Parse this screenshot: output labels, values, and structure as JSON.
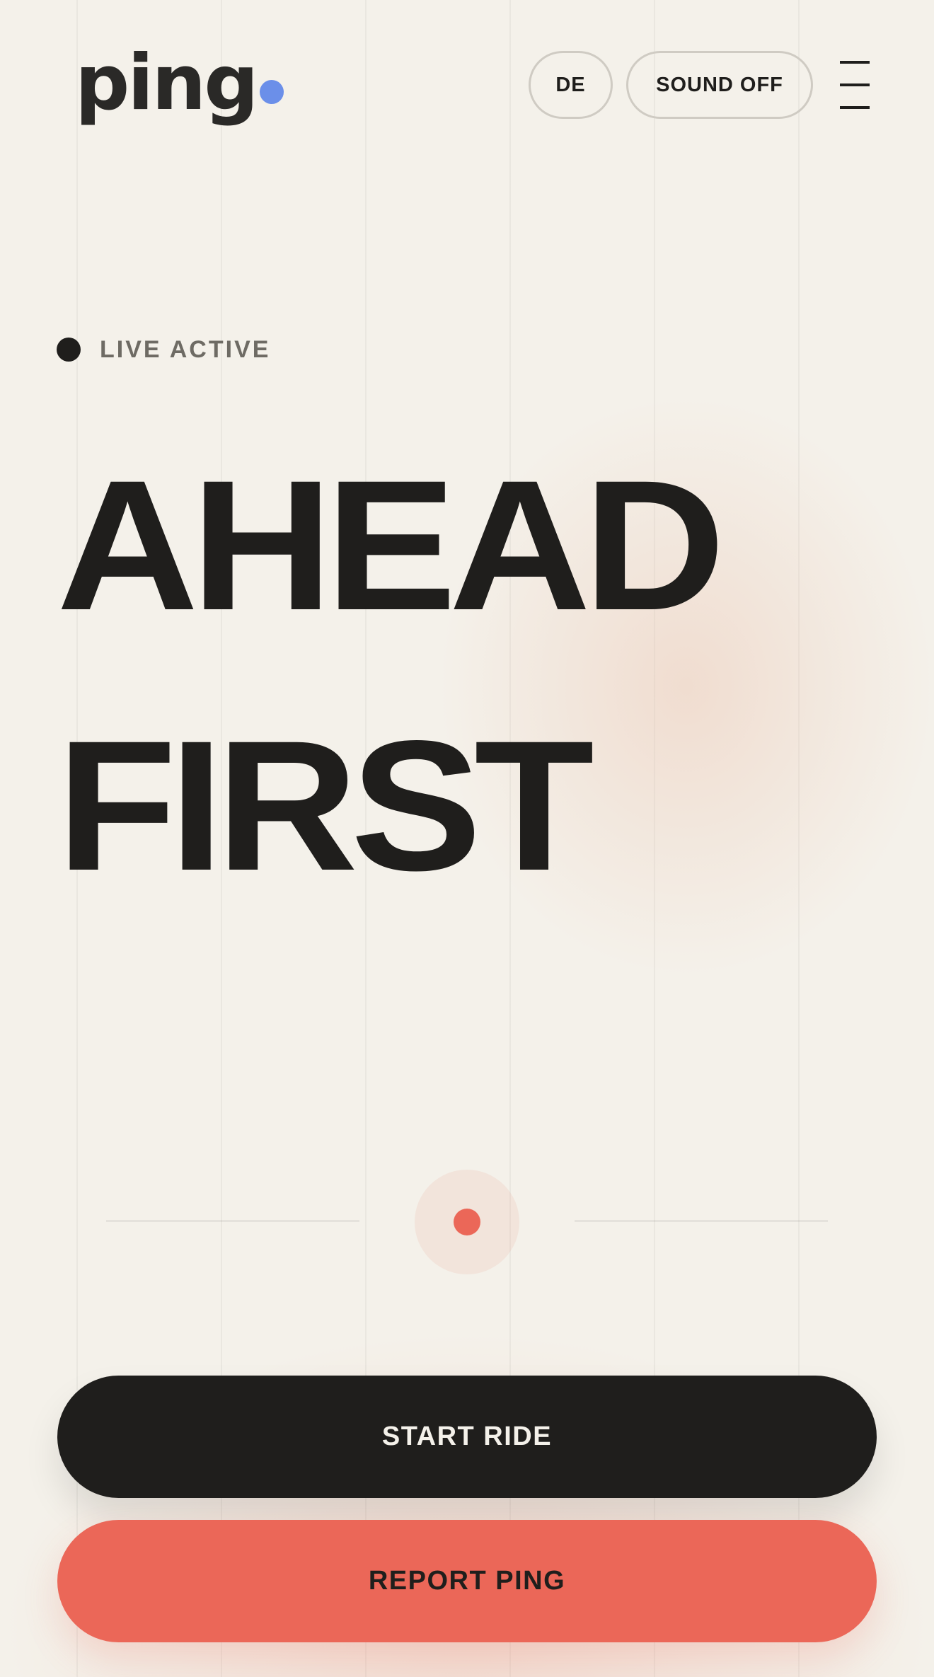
{
  "header": {
    "logo_text": "ping",
    "language_label": "DE",
    "sound_label": "SOUND OFF",
    "menu_icon": "hamburger-menu-icon"
  },
  "status": {
    "label": "LIVE ACTIVE"
  },
  "hero": {
    "line1": "AHEAD",
    "line2": "FIRST"
  },
  "actions": {
    "start_label": "START RIDE",
    "report_label": "REPORT PING"
  },
  "colors": {
    "background": "#F4F1EA",
    "text": "#1F1E1C",
    "accent_blue": "#6B8FE9",
    "accent_coral": "#EB6758",
    "muted_text": "#6E6B64"
  }
}
